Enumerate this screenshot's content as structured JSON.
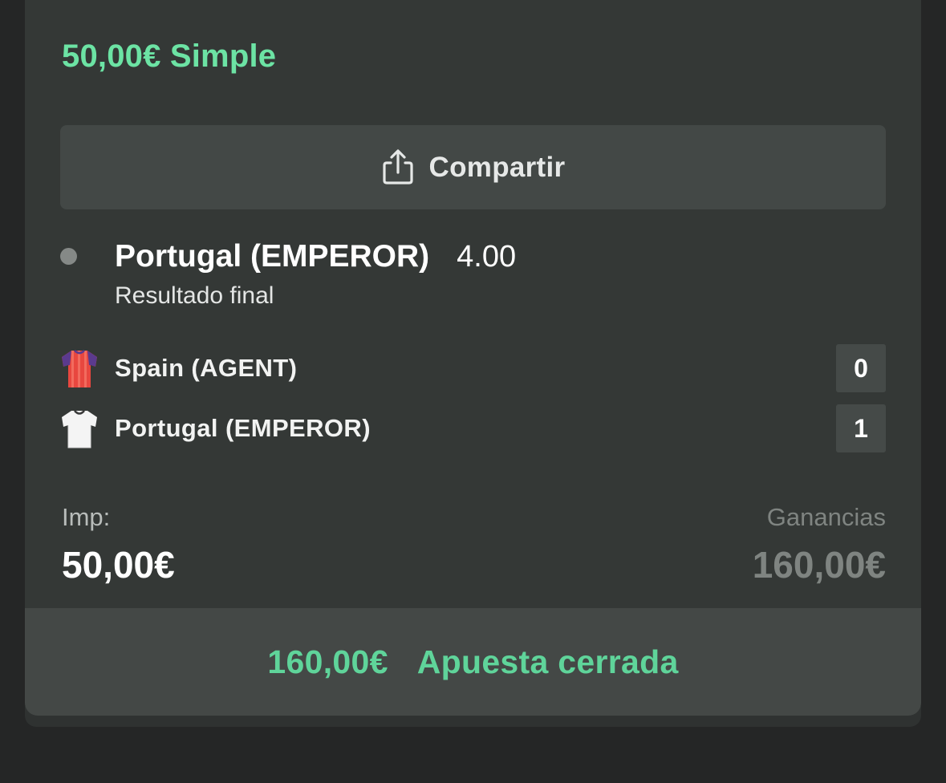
{
  "bet": {
    "header": "50,00€ Simple",
    "share_label": "Compartir",
    "share_icon": "share-icon",
    "selection": {
      "name": "Portugal (EMPEROR)",
      "odds": "4.00",
      "market": "Resultado final"
    },
    "teams": [
      {
        "name": "Spain (AGENT)",
        "score": "0",
        "kit_icon": "red-shirt-icon"
      },
      {
        "name": "Portugal (EMPEROR)",
        "score": "1",
        "kit_icon": "white-shirt-icon"
      }
    ],
    "stake_label": "Imp:",
    "stake_value": "50,00€",
    "winnings_label": "Ganancias",
    "winnings_value": "160,00€",
    "result_amount": "160,00€",
    "result_status": "Apuesta cerrada"
  },
  "colors": {
    "accent_green": "#6ce3a4",
    "status_green": "#5fd49a",
    "card_bg": "#343836",
    "muted_text": "#7f8481"
  }
}
